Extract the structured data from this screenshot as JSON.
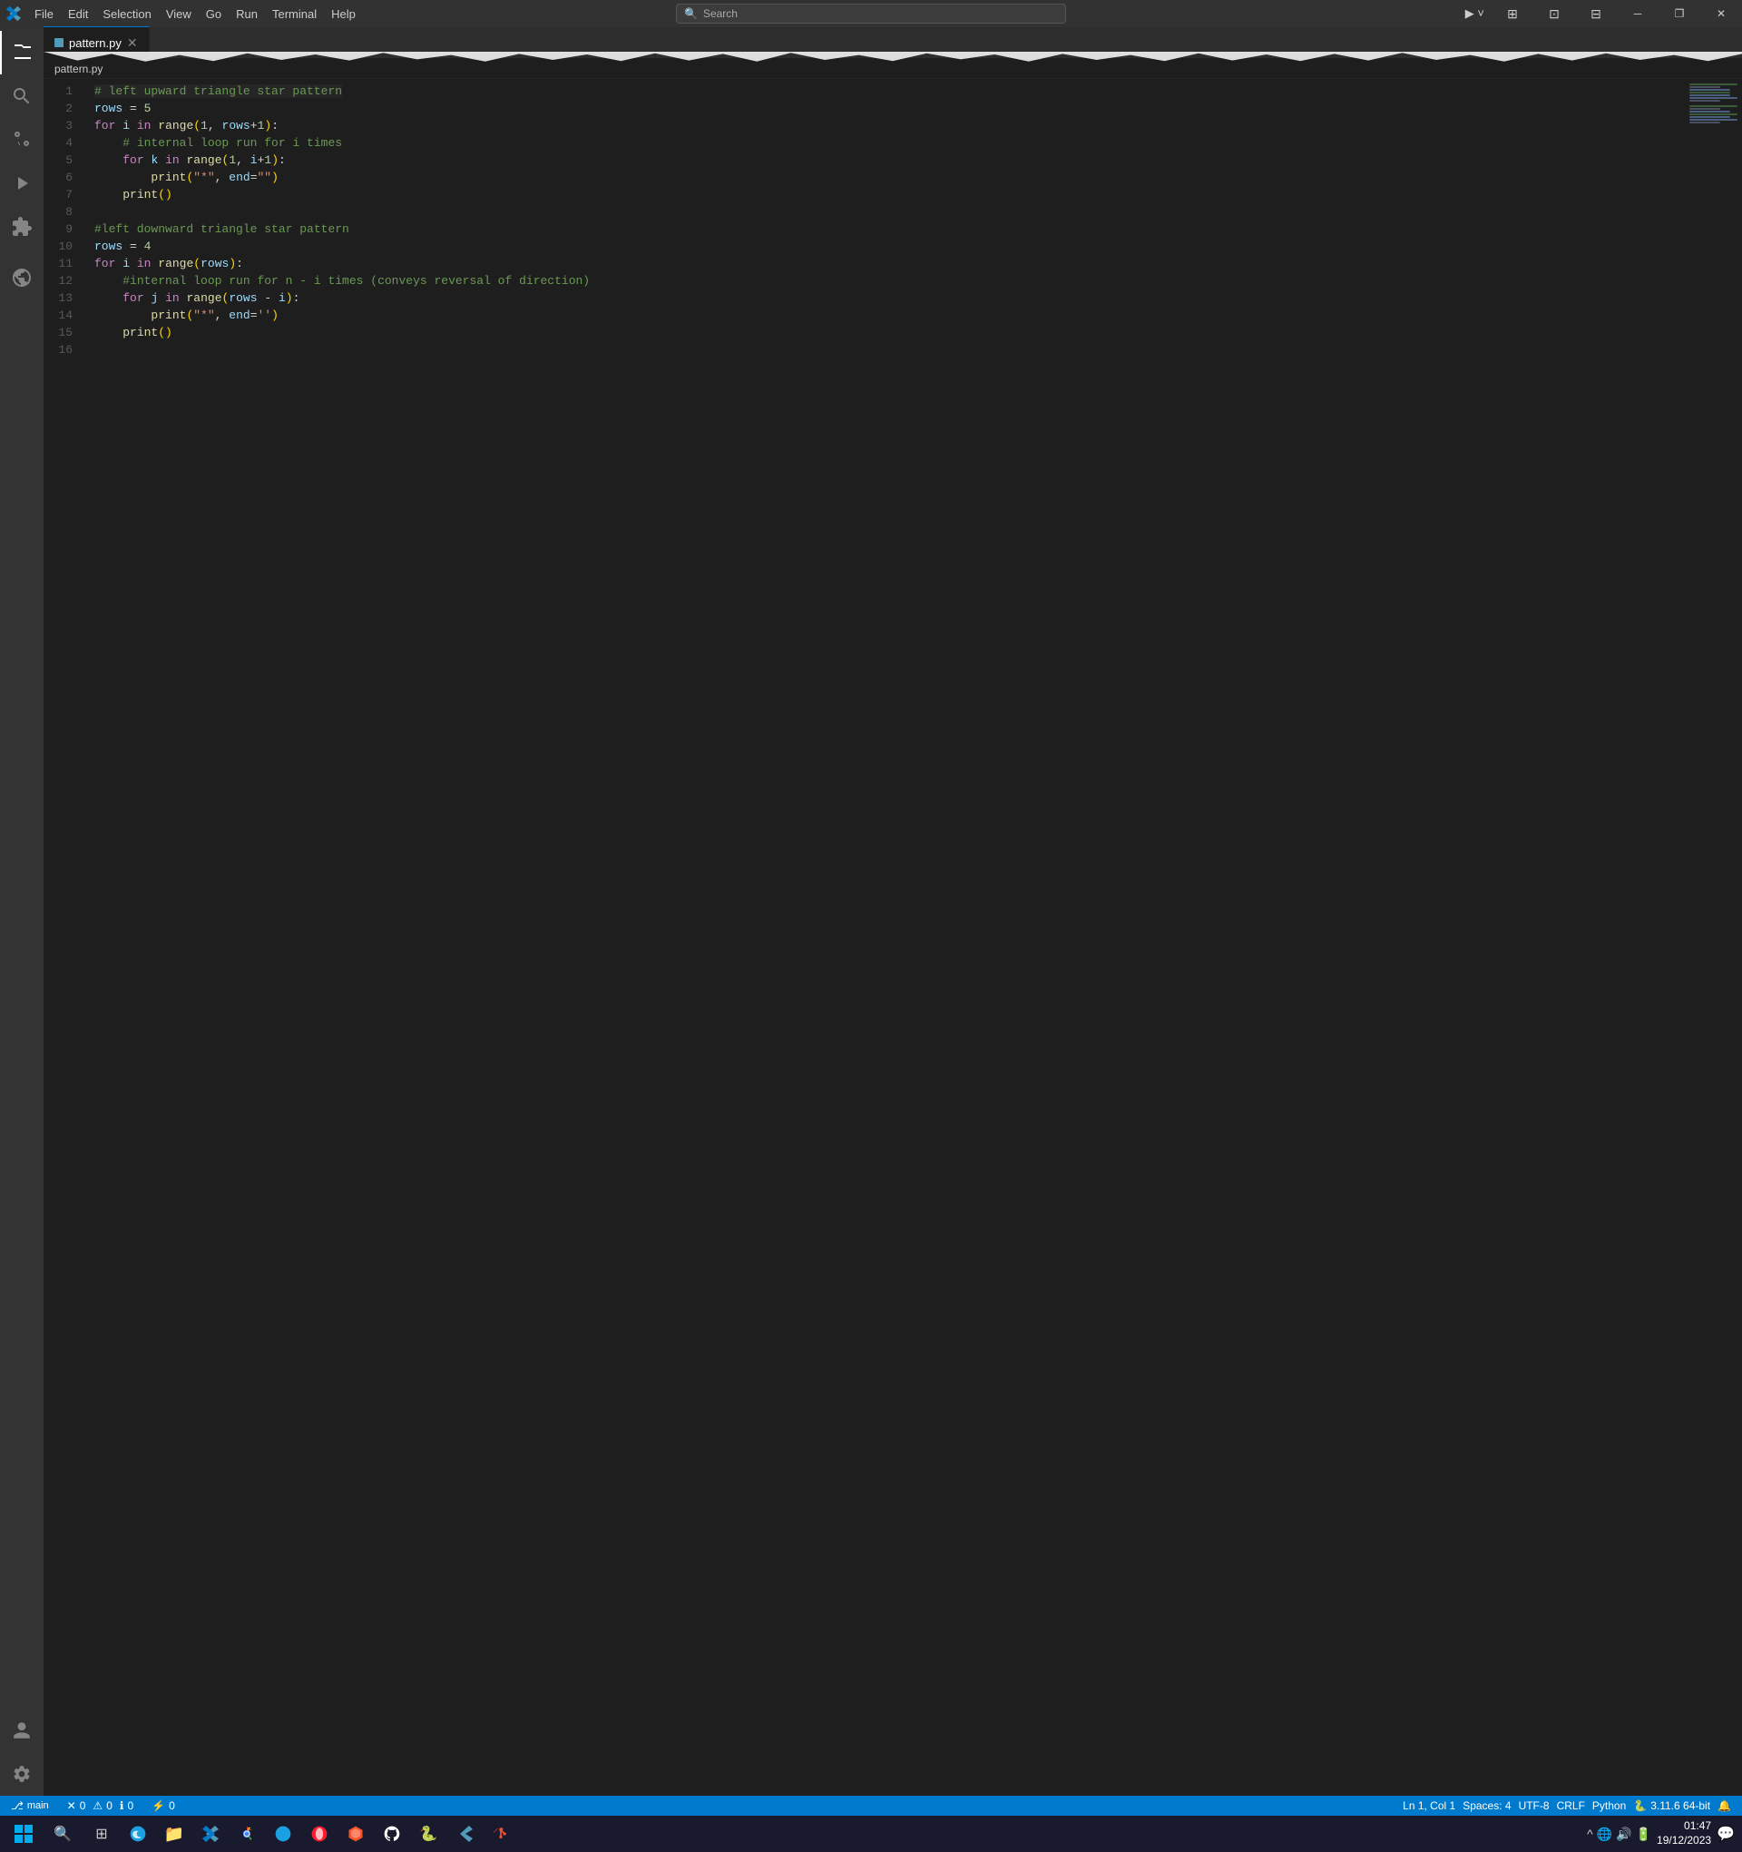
{
  "titlebar": {
    "menus": [
      "File",
      "Edit",
      "Selection",
      "View",
      "Go",
      "Run",
      "Terminal",
      "Help"
    ],
    "search_placeholder": "Search",
    "back_btn": "←",
    "forward_btn": "→",
    "minimize": "─",
    "maximize": "□",
    "restore": "❐",
    "close": "✕"
  },
  "tabs": [
    {
      "name": "pattern.py",
      "active": true,
      "icon": "python"
    }
  ],
  "breadcrumb": [
    "pattern.py"
  ],
  "code": {
    "lines": [
      {
        "n": 1,
        "text": "# left upward triangle star pattern",
        "type": "comment"
      },
      {
        "n": 2,
        "text": "rows = 5",
        "type": "code"
      },
      {
        "n": 3,
        "text": "for i in range(1, rows+1):",
        "type": "code"
      },
      {
        "n": 4,
        "text": "    # internal loop run for i times",
        "type": "comment"
      },
      {
        "n": 5,
        "text": "    for k in range(1, i+1):",
        "type": "code"
      },
      {
        "n": 6,
        "text": "        print(\"*\", end=\"\")",
        "type": "code"
      },
      {
        "n": 7,
        "text": "    print()",
        "type": "code"
      },
      {
        "n": 8,
        "text": "",
        "type": "blank"
      },
      {
        "n": 9,
        "text": "#left downward triangle star pattern",
        "type": "comment"
      },
      {
        "n": 10,
        "text": "rows = 4",
        "type": "code"
      },
      {
        "n": 11,
        "text": "for i in range(rows):",
        "type": "code"
      },
      {
        "n": 12,
        "text": "    #internal loop run for n - i times (conveys reversal of direction)",
        "type": "comment"
      },
      {
        "n": 13,
        "text": "    for j in range(rows - i):",
        "type": "code"
      },
      {
        "n": 14,
        "text": "        print(\"*\", end='')",
        "type": "code"
      },
      {
        "n": 15,
        "text": "    print()",
        "type": "code"
      },
      {
        "n": 16,
        "text": "",
        "type": "blank"
      }
    ]
  },
  "status_bar": {
    "errors": "0",
    "warnings": "0",
    "info": "0",
    "port": "0",
    "ln": "Ln 1, Col 1",
    "spaces": "Spaces: 4",
    "encoding": "UTF-8",
    "eol": "CRLF",
    "language": "Python",
    "version": "3.11.6 64-bit",
    "notifications": ""
  },
  "taskbar": {
    "time": "01:47",
    "date": "19/12/2023",
    "icons": [
      "windows",
      "search",
      "taskview",
      "edge",
      "file-explorer",
      "vscode",
      "chrome",
      "edge2",
      "opera",
      "brave",
      "github",
      "python",
      "vscode2",
      "git"
    ]
  },
  "activity_bar": {
    "icons": [
      "explorer",
      "search",
      "source-control",
      "run-debug",
      "extensions",
      "remote-explorer"
    ],
    "bottom_icons": [
      "accounts",
      "settings"
    ]
  }
}
